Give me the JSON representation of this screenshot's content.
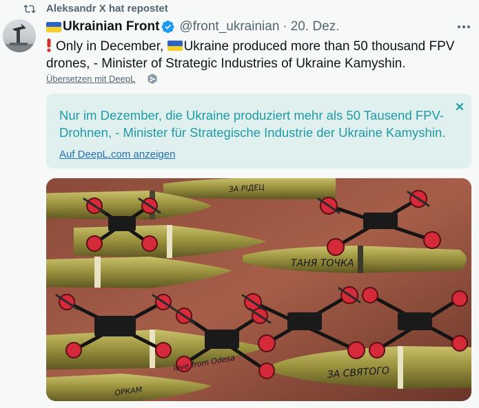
{
  "repost": {
    "icon": "repost-icon",
    "text": "Aleksandr X hat repostet"
  },
  "author": {
    "flag": "ukraine-flag",
    "name": "Ukrainian Front",
    "verified_icon": "verified-badge-icon",
    "handle": "@front_ukrainian",
    "separator": "·",
    "date": "20. Dez."
  },
  "post": {
    "text_part1": "Only in December, ",
    "text_part2": "Ukraine produced more than 50 thousand FPV drones, - Minister of Strategic Industries of Ukraine Kamyshin."
  },
  "translate": {
    "link_label": "Übersetzen mit DeepL",
    "translated_text": "Nur im Dezember, die Ukraine produziert mehr als 50 Tausend FPV-Drohnen, - Minister für Strategische Industrie der Ukraine Kamyshin.",
    "open_link_label": "Auf DeepL.com anzeigen"
  },
  "photo": {
    "inscriptions": [
      "ЗА РІДЕЦ",
      "ТАНЯ ТОЧКА",
      "love from Odesa",
      "ЗА СВЯТОГО",
      "ОРКАМ"
    ]
  },
  "colors": {
    "accent": "#1d9bf0",
    "translation_bg": "#dff0ef",
    "translation_text": "#1f9aa4",
    "muted": "#536471"
  }
}
